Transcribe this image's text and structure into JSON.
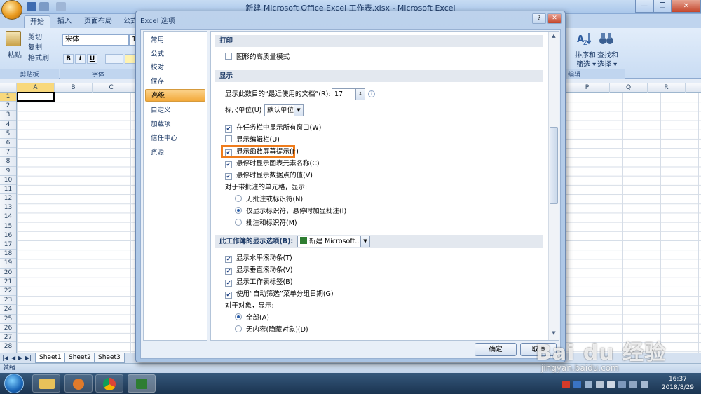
{
  "app": {
    "window_title": "新建 Microsoft Office Excel 工作表.xlsx - Microsoft Excel",
    "controls": {
      "minimize": "—",
      "restore": "❐",
      "close": "✕"
    }
  },
  "ribbon": {
    "tabs": [
      "开始",
      "插入",
      "页面布局",
      "公式"
    ],
    "clipboard": {
      "paste": "粘贴",
      "cut": "剪切",
      "copy": "复制",
      "format_painter": "格式刷",
      "group_label": "剪贴板"
    },
    "font": {
      "name": "宋体",
      "size": "1",
      "bold": "B",
      "italic": "I",
      "underline": "U",
      "group_label": "字体"
    },
    "editing": {
      "sort_filter": "排序和\n筛选",
      "sort_filter_l1": "排序和",
      "sort_filter_l2": "筛选 ▾",
      "find_l1": "查找和",
      "find_l2": "选择 ▾",
      "group_label": "编辑"
    }
  },
  "sheet": {
    "left_columns": [
      "A",
      "B",
      "C"
    ],
    "right_columns": [
      "P",
      "Q",
      "R"
    ],
    "rows": [
      "1",
      "2",
      "3",
      "4",
      "5",
      "6",
      "7",
      "8",
      "9",
      "10",
      "11",
      "12",
      "13",
      "14",
      "15",
      "16",
      "17",
      "18",
      "19",
      "20",
      "21",
      "22",
      "23",
      "24",
      "25",
      "26",
      "27",
      "28"
    ],
    "sheet_tabs": [
      "Sheet1",
      "Sheet2",
      "Sheet3"
    ],
    "status": "就绪"
  },
  "dialog": {
    "title": "Excel 选项",
    "help": "?",
    "close": "✕",
    "nav": [
      "常用",
      "公式",
      "校对",
      "保存",
      "高级",
      "自定义",
      "加载项",
      "信任中心",
      "资源"
    ],
    "active_nav": "高级",
    "print_section": "打印",
    "print_hq": "图形的高质量模式",
    "display_section": "显示",
    "recent_docs_label": "显示此数目的“最近使用的文档”(R):",
    "recent_docs_value": "17",
    "ruler_label": "标尺单位(U)",
    "ruler_value": "默认单位",
    "show_all_windows": "在任务栏中显示所有窗口(W)",
    "show_formula_bar": "显示编辑栏(U)",
    "show_function_tips": "显示函数屏幕提示(F)",
    "show_chart_names": "悬停时显示图表元素名称(C)",
    "show_data_values": "悬停时显示数据点的值(V)",
    "comments_label": "对于带批注的单元格，显示:",
    "comments_none": "无批注或标识符(N)",
    "comments_indicator": "仅显示标识符，悬停时加显批注(I)",
    "comments_both": "批注和标识符(M)",
    "workbook_section": "此工作簿的显示选项(B):",
    "workbook_value": "新建 Microsoft...",
    "show_hscroll": "显示水平滚动条(T)",
    "show_vscroll": "显示垂直滚动条(V)",
    "show_sheet_tabs": "显示工作表标签(B)",
    "group_dates": "使用“自动筛选”菜单分组日期(G)",
    "objects_label": "对于对象，显示:",
    "objects_all": "全部(A)",
    "objects_none": "无内容(隐藏对象)(D)",
    "ok": "确定",
    "cancel": "取消"
  },
  "taskbar": {
    "time": "16:37",
    "date": "2018/8/29"
  },
  "watermark": {
    "logo": "Bai du 经验",
    "url": "jingyan.baidu.com"
  },
  "colors": {
    "highlight_box": "#ef7c1c",
    "active_nav": "#f3a93a",
    "ribbon": "#c9dcf3"
  }
}
